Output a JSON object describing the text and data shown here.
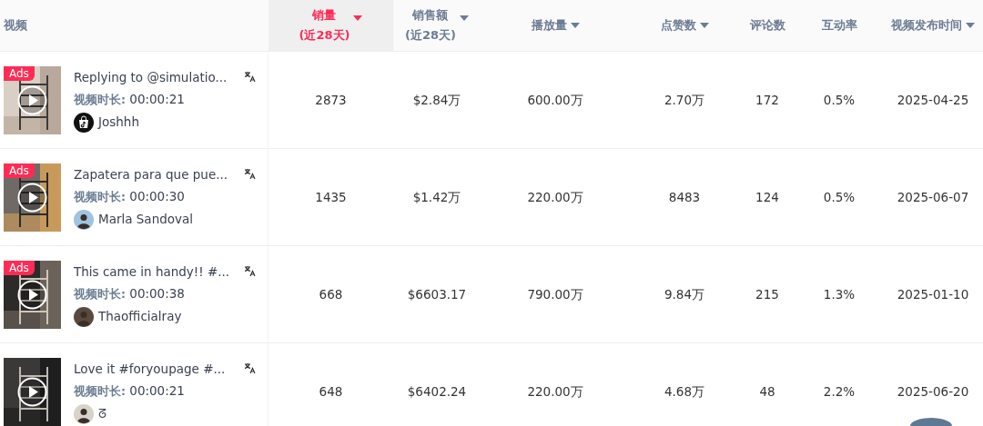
{
  "columns": [
    {
      "label": "视频"
    },
    {
      "label": "销量",
      "sublabel": "(近28天)",
      "sortable": true,
      "selected": true
    },
    {
      "label": "销售额",
      "sublabel": "(近28天)",
      "sortable": true,
      "selected": false
    },
    {
      "label": "播放量",
      "sortable": true,
      "selected": false
    },
    {
      "label": "点赞数",
      "sortable": true,
      "selected": false
    },
    {
      "label": "评论数",
      "sortable": false
    },
    {
      "label": "互动率",
      "sortable": false
    },
    {
      "label": "视频发布时间",
      "sortable": true,
      "selected": false
    }
  ],
  "rows": [
    {
      "ad_badge": "Ads",
      "title": "Replying to @simulatio...",
      "duration_label": "视频时长:",
      "duration": "00:00:21",
      "creator": "Joshhh",
      "avatar": {
        "kind": "shop"
      },
      "sales": "2873",
      "revenue": "$2.84万",
      "views": "600.00万",
      "likes": "2.70万",
      "comments": "172",
      "engagement": "0.5%",
      "published": "2025-04-25"
    },
    {
      "ad_badge": "Ads",
      "title": "Zapatera para que pue...",
      "duration_label": "视频时长:",
      "duration": "00:00:30",
      "creator": "Marla Sandoval",
      "sales": "1435",
      "revenue": "$1.42万",
      "views": "220.00万",
      "likes": "8483",
      "comments": "124",
      "engagement": "0.5%",
      "published": "2025-06-07"
    },
    {
      "ad_badge": "Ads",
      "title": "This came in handy!! #...",
      "duration_label": "视频时长:",
      "duration": "00:00:38",
      "creator": "Thaofficialray",
      "sales": "668",
      "revenue": "$6603.17",
      "views": "790.00万",
      "likes": "9.84万",
      "comments": "215",
      "engagement": "1.3%",
      "published": "2025-01-10"
    },
    {
      "title": "Love it #foryoupage #...",
      "duration_label": "视频时长:",
      "duration": "00:00:21",
      "creator": "ᘔ",
      "sales": "648",
      "revenue": "$6402.24",
      "views": "220.00万",
      "likes": "4.68万",
      "comments": "48",
      "engagement": "2.2%",
      "published": "2025-06-20"
    }
  ]
}
